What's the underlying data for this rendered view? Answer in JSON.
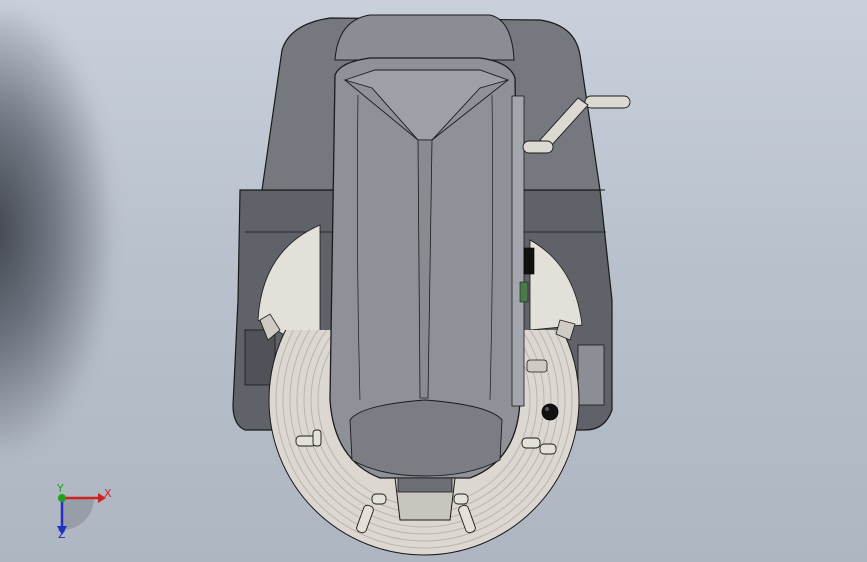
{
  "viewport": {
    "background_top": "#c9d0db",
    "background_bottom": "#aeb6c2"
  },
  "model": {
    "body_color": "#6f7278",
    "top_shell_color": "#83868c",
    "cushion_color": "#9a9da3",
    "cable_coil_color": "#dedbd5",
    "handle_color": "#d9d6d0",
    "outline_color": "#1a1a1a"
  },
  "triad": {
    "x_label": "X",
    "y_label": "Y",
    "z_label": "Z",
    "x_color": "#d02020",
    "y_color": "#20a020",
    "z_color": "#2030c0"
  }
}
